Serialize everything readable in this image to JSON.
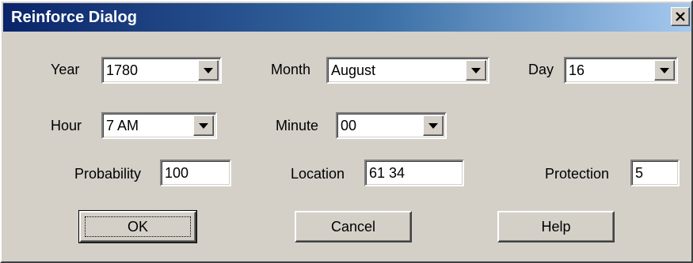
{
  "window": {
    "title": "Reinforce Dialog"
  },
  "fields": {
    "year": {
      "label": "Year",
      "value": "1780"
    },
    "month": {
      "label": "Month",
      "value": "August"
    },
    "day": {
      "label": "Day",
      "value": "16"
    },
    "hour": {
      "label": "Hour",
      "value": "7 AM"
    },
    "minute": {
      "label": "Minute",
      "value": "00"
    },
    "probability": {
      "label": "Probability",
      "value": "100"
    },
    "location": {
      "label": "Location",
      "value": "61 34"
    },
    "protection": {
      "label": "Protection",
      "value": "5"
    }
  },
  "buttons": {
    "ok": "OK",
    "cancel": "Cancel",
    "help": "Help"
  },
  "icons": {
    "close": "close-icon",
    "dropdown": "chevron-down-icon"
  },
  "colors": {
    "face": "#d4d0c8",
    "title_start": "#0a246a",
    "title_end": "#a6caf0"
  }
}
